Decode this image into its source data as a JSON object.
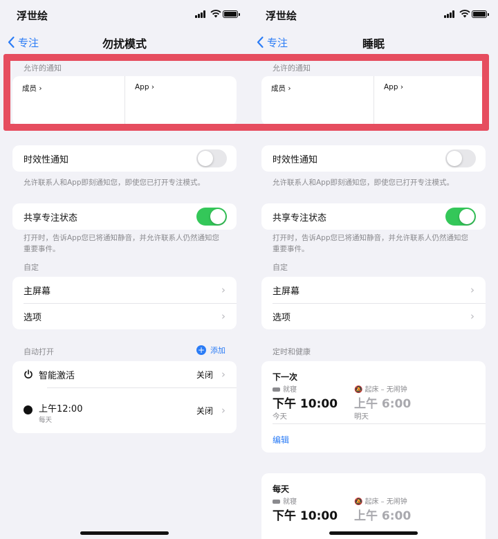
{
  "left_screen": {
    "carrier": "浮世绘",
    "back_label": "专注",
    "title": "勿扰模式",
    "allowed_notifications_header": "允许的通知",
    "members_label": "成员",
    "app_label": "App",
    "time_sensitive_label": "时效性通知",
    "time_sensitive_on": false,
    "time_sensitive_desc": "允许联系人和App即刻通知您，即使您已打开专注模式。",
    "share_status_label": "共享专注状态",
    "share_status_on": true,
    "share_status_desc_1": "打开时，告诉App您已将通知静音，并允许联系人仍然通知您",
    "share_status_desc_2": "重要事件。",
    "customize_header": "自定",
    "home_screen_label": "主屏幕",
    "options_label": "选项",
    "auto_on_header": "自动打开",
    "add_label": "添加",
    "smart_activation_label": "智能激活",
    "smart_activation_value": "关闭",
    "schedule_time": "上午12:00",
    "schedule_repeat": "每天",
    "schedule_value": "关闭"
  },
  "right_screen": {
    "carrier": "浮世绘",
    "back_label": "专注",
    "title": "睡眠",
    "allowed_notifications_header": "允许的通知",
    "members_label": "成员",
    "app_label": "App",
    "time_sensitive_label": "时效性通知",
    "time_sensitive_on": false,
    "time_sensitive_desc": "允许联系人和App即刻通知您，即使您已打开专注模式。",
    "share_status_label": "共享专注状态",
    "share_status_on": true,
    "share_status_desc_1": "打开时，告诉App您已将通知静音，并允许联系人仍然通知您",
    "share_status_desc_2": "重要事件。",
    "customize_header": "自定",
    "home_screen_label": "主屏幕",
    "options_label": "选项",
    "schedule_header": "定时和健康",
    "next_title": "下一次",
    "bedtime_label": "就寝",
    "bedtime_value": "下午 10:00",
    "bedtime_day": "今天",
    "wake_label": "起床 – 无闹钟",
    "wake_value": "上午 6:00",
    "wake_day": "明天",
    "edit_label": "编辑",
    "daily_title": "每天",
    "daily_bedtime_label": "就寝",
    "daily_bedtime_value": "下午 10:00",
    "daily_wake_label": "起床 – 无闹钟",
    "daily_wake_value": "上午 6:00"
  },
  "colors": {
    "accent_blue": "#2b7cf6",
    "toggle_green": "#34c759",
    "highlight_red": "#e64d5f",
    "background": "#f2f2f7"
  }
}
